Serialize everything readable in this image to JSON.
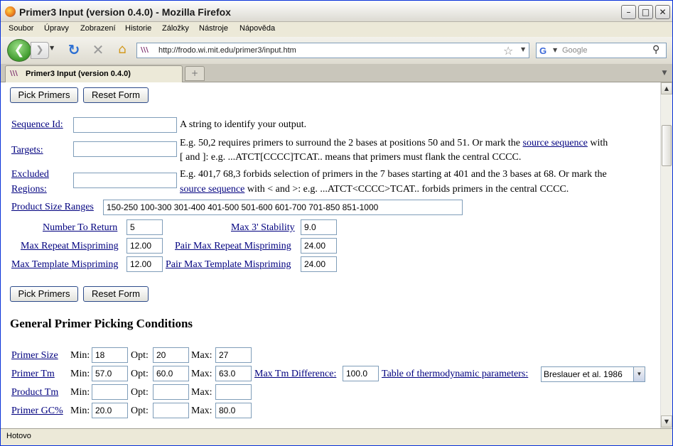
{
  "window": {
    "title": "Primer3 Input (version 0.4.0) - Mozilla Firefox"
  },
  "menu": [
    "Soubor",
    "Úpravy",
    "Zobrazení",
    "Historie",
    "Záložky",
    "Nástroje",
    "Nápověda"
  ],
  "nav": {
    "url": "http://frodo.wi.mit.edu/primer3/input.htm",
    "search_placeholder": "Google"
  },
  "tabs": [
    {
      "label": "Primer3 Input (version 0.4.0)"
    }
  ],
  "status": "Hotovo",
  "form": {
    "pick_primers": "Pick Primers",
    "reset_form": "Reset Form",
    "sequence_id": {
      "label": "Sequence Id:",
      "value": "",
      "help": "A string to identify your output."
    },
    "targets": {
      "label": "Targets:",
      "value": "",
      "help1a": "E.g. 50,2 requires primers to surround the 2 bases at positions 50 and 51. Or mark the",
      "help1_link": "source sequence",
      "help1b": "with",
      "help2": "[ and ]: e.g. ...ATCT[CCCC]TCAT.. means that primers must flank the central CCCC."
    },
    "excluded": {
      "label1": "Excluded",
      "label2": "Regions:",
      "value": "",
      "help1": "E.g. 401,7 68,3 forbids selection of primers in the 7 bases starting at 401 and the 3 bases at 68. Or mark the",
      "help2_link": "source sequence",
      "help2": "with < and >: e.g. ...ATCT<CCCC>TCAT.. forbids primers in the central CCCC."
    },
    "product_size": {
      "label": "Product Size Ranges",
      "value": "150-250 100-300 301-400 401-500 501-600 601-700 701-850 851-1000"
    },
    "num_return": {
      "label": "Number To Return",
      "value": "5"
    },
    "max3_stability": {
      "label": "Max 3' Stability",
      "value": "9.0"
    },
    "max_repeat": {
      "label": "Max Repeat Mispriming",
      "value": "12.00"
    },
    "pair_max_repeat": {
      "label": "Pair Max Repeat Mispriming",
      "value": "24.00"
    },
    "max_template": {
      "label": "Max Template Mispriming",
      "value": "12.00"
    },
    "pair_max_template": {
      "label": "Pair Max Template Mispriming",
      "value": "24.00"
    }
  },
  "general": {
    "heading": "General Primer Picking Conditions",
    "min_label": "Min:",
    "opt_label": "Opt:",
    "max_label": "Max:",
    "primer_size": {
      "label": "Primer Size",
      "min": "18",
      "opt": "20",
      "max": "27"
    },
    "primer_tm": {
      "label": "Primer Tm",
      "min": "57.0",
      "opt": "60.0",
      "max": "63.0"
    },
    "max_tm_diff": {
      "label": "Max Tm Difference:",
      "value": "100.0"
    },
    "thermo_table": {
      "label": "Table of thermodynamic parameters:",
      "selected": "Breslauer et al. 1986"
    },
    "product_tm": {
      "label": "Product Tm",
      "min": "",
      "opt": "",
      "max": ""
    },
    "primer_gc": {
      "label": "Primer GC%",
      "min": "20.0",
      "opt": "",
      "max": "80.0"
    }
  }
}
